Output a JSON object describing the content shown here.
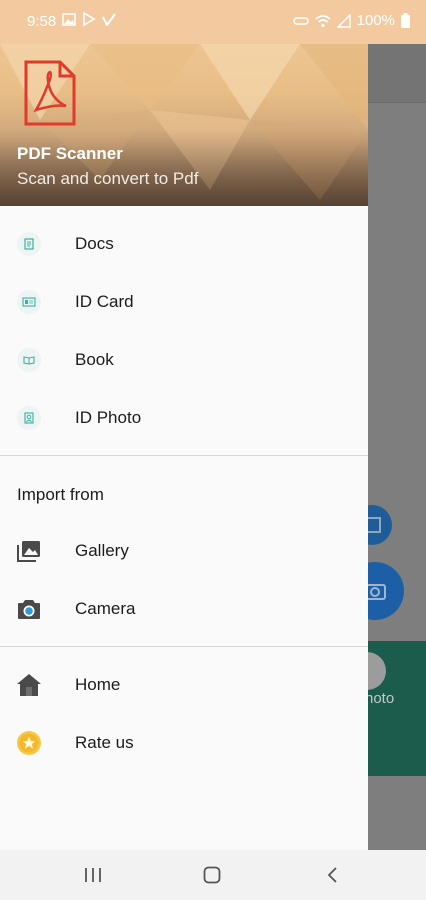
{
  "status_bar": {
    "time": "9:58",
    "battery": "100%"
  },
  "drawer": {
    "app_name": "PDF Scanner",
    "subtitle": "Scan and convert to Pdf",
    "scan_items": [
      {
        "label": "Docs",
        "icon": "docs-icon"
      },
      {
        "label": "ID Card",
        "icon": "id-card-icon"
      },
      {
        "label": "Book",
        "icon": "book-icon"
      },
      {
        "label": "ID Photo",
        "icon": "id-photo-icon"
      }
    ],
    "import_title": "Import from",
    "import_items": [
      {
        "label": "Gallery",
        "icon": "gallery-icon"
      },
      {
        "label": "Camera",
        "icon": "camera-icon"
      }
    ],
    "other_items": [
      {
        "label": "Home",
        "icon": "home-icon"
      },
      {
        "label": "Rate us",
        "icon": "star-icon"
      }
    ]
  },
  "background": {
    "card_text": "hoto"
  },
  "colors": {
    "header": "#f1cd9f",
    "status_bar": "#f3caa0",
    "accent_teal": "#36b3a0",
    "rate_star": "#f6c945"
  }
}
